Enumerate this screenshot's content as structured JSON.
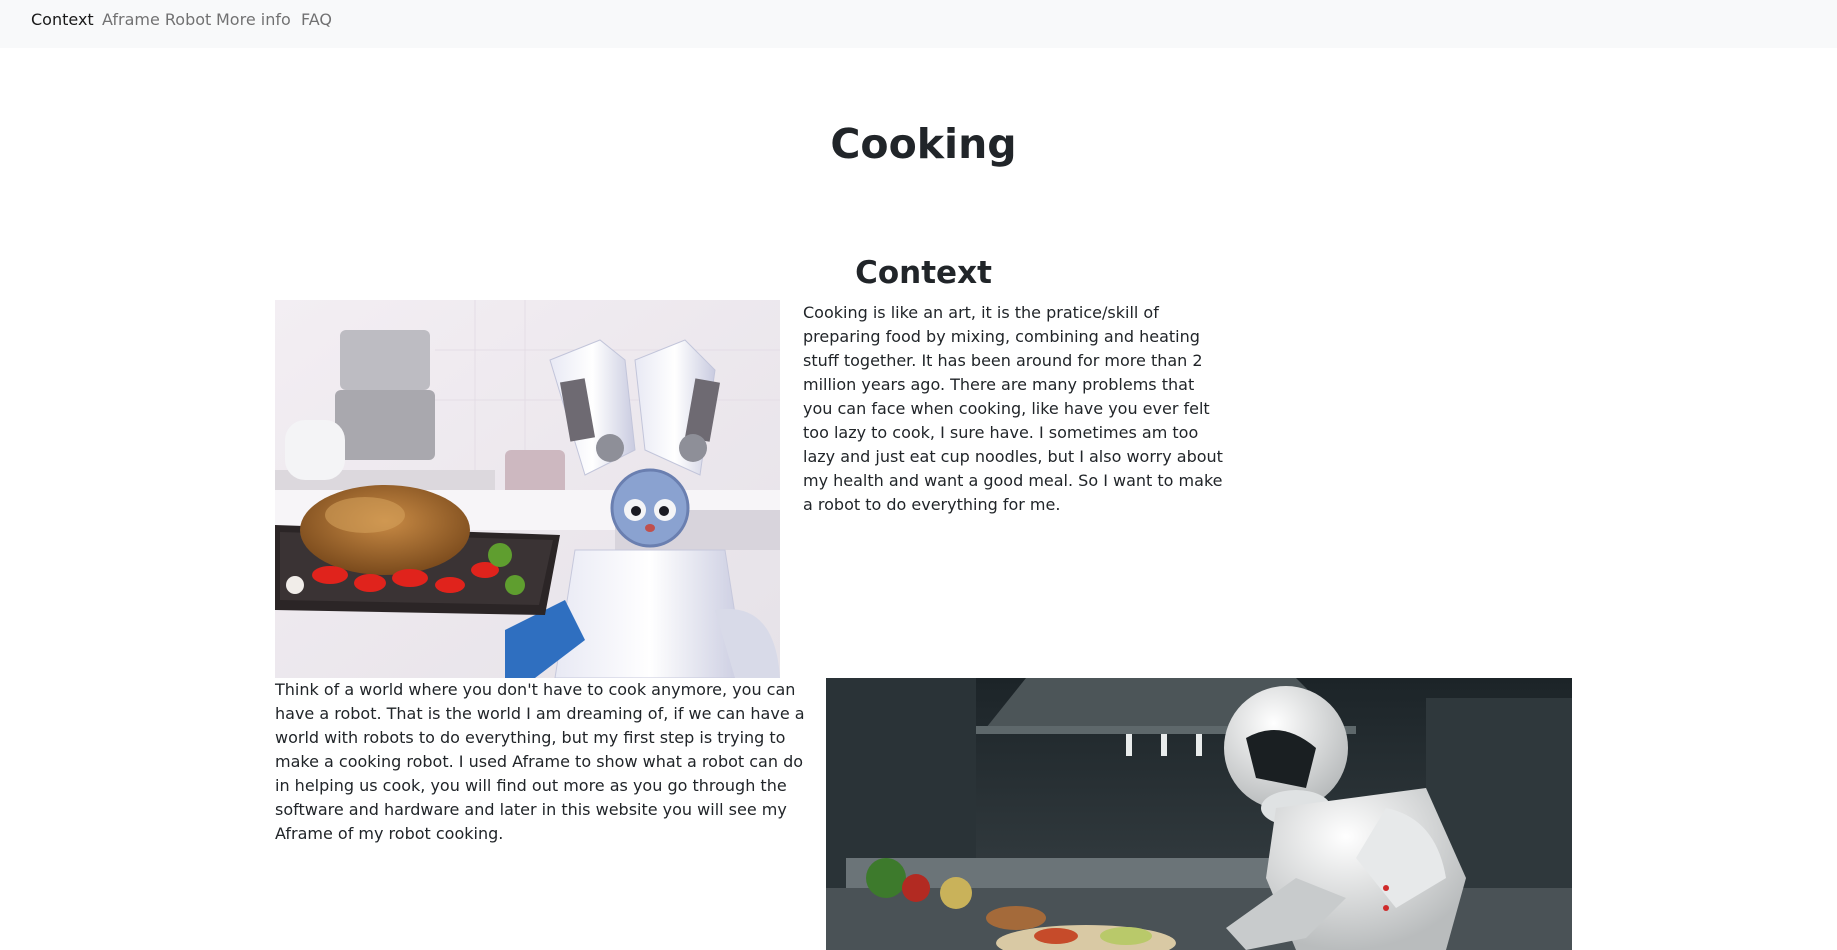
{
  "nav": {
    "items": [
      {
        "label": "Context"
      },
      {
        "label": "Aframe Robot"
      },
      {
        "label": "More info"
      },
      {
        "label": "FAQ"
      }
    ]
  },
  "page": {
    "title": "Cooking",
    "section_title": "Context",
    "paragraph_1": "Cooking is like an art, it is the pratice/skill of preparing food by mixing, combining and heating stuff together. It has been around for more than 2 million years ago. There are many problems that you can face when cooking, like have you ever felt too lazy to cook, I sure have. I sometimes am too lazy and just eat cup noodles, but I also worry about my health and want a good meal. So I want to make a robot to do everything for me.",
    "paragraph_2": "Think of a world where you don't have to cook anymore, you can have a robot. That is the world I am dreaming of, if we can have a world with robots to do everything, but my first step is trying to make a cooking robot. I used Aframe to show what a robot can do in helping us cook, you will find out more as you go through the software and hardware and later in this website you will see my Aframe of my robot cooking."
  },
  "colors": {
    "navbar_bg": "#f8f9fa",
    "text": "#212529"
  }
}
